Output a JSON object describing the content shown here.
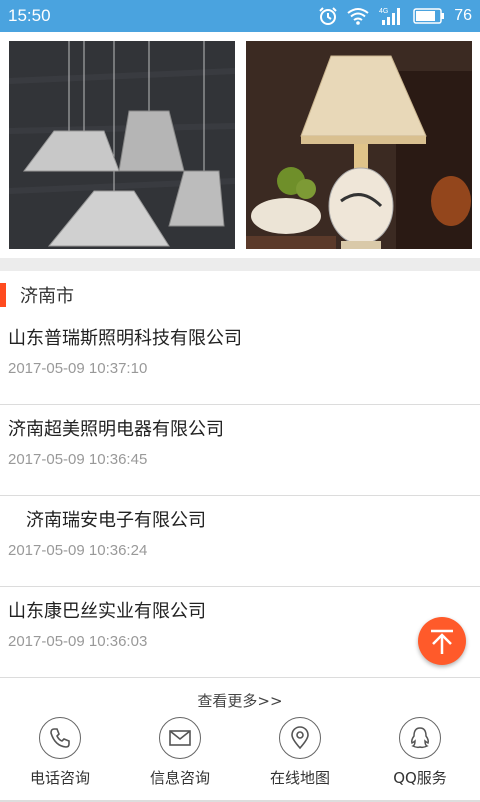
{
  "status_bar": {
    "time": "15:50",
    "battery": "76",
    "icons": [
      "alarm-icon",
      "wifi-icon",
      "signal-4g-icon",
      "battery-icon"
    ],
    "network_label": "4G"
  },
  "section": {
    "title": "济南市"
  },
  "companies": [
    {
      "name": "山东普瑞斯照明科技有限公司",
      "date": "2017-05-09 10:37:10"
    },
    {
      "name": "济南超美照明电器有限公司",
      "date": "2017-05-09 10:36:45"
    },
    {
      "name": "　济南瑞安电子有限公司",
      "date": "2017-05-09 10:36:24"
    },
    {
      "name": "山东康巴丝实业有限公司",
      "date": "2017-05-09 10:36:03"
    }
  ],
  "more_link": "查看更多>>",
  "bottom_nav": [
    {
      "label": "电话咨询",
      "icon": "phone-icon"
    },
    {
      "label": "信息咨询",
      "icon": "mail-icon"
    },
    {
      "label": "在线地图",
      "icon": "map-pin-icon"
    },
    {
      "label": "QQ服务",
      "icon": "qq-icon"
    }
  ],
  "colors": {
    "status_bar": "#4aa3df",
    "accent": "#ff4b1f",
    "back_to_top": "#ff5a2a"
  }
}
